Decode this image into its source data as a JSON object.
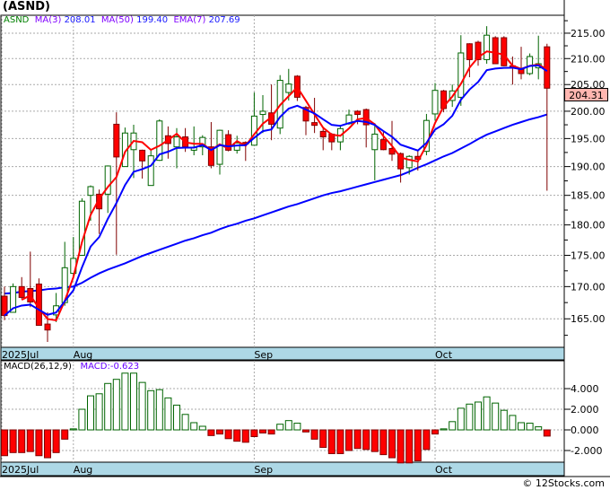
{
  "title": "(ASND)",
  "legend": {
    "symbol": "ASND",
    "ma3_label": "MA(3)",
    "ma3_value": "208.01",
    "ma50_label": "MA(50)",
    "ma50_value": "199.40",
    "ema7_label": "EMA(7)",
    "ema7_value": "207.69"
  },
  "last_price": "204.31",
  "macd_legend": {
    "label": "MACD(26,12,9)",
    "value": "MACD:-0.623"
  },
  "footer": "© 12Stocks.com",
  "colors": {
    "up": "#006400",
    "down": "#ff0000",
    "down_edge": "#800000",
    "ma3": "#ff0000",
    "ema7": "#0000ff",
    "ma50": "#0000ff",
    "axis_band": "#add8e6",
    "last_box": "#ffb6b0"
  },
  "chart_data": [
    {
      "type": "candlestick",
      "scale": "log",
      "ylim": [
        160.7,
        218.6
      ],
      "grid": true,
      "yticks": [
        "215.00",
        "210.00",
        "205.00",
        "200.00",
        "195.00",
        "190.00",
        "185.00",
        "180.00",
        "175.00",
        "170.00",
        "165.00"
      ],
      "xticks": [
        {
          "label": "2025Jul",
          "index": 0
        },
        {
          "label": "Aug",
          "index": 8
        },
        {
          "label": "Sep",
          "index": 29
        },
        {
          "label": "Oct",
          "index": 50
        }
      ],
      "ohlc": [
        [
          168.5,
          170,
          164.8,
          165.5
        ],
        [
          166,
          170.5,
          166,
          170
        ],
        [
          170,
          171.5,
          168,
          168.3
        ],
        [
          169.7,
          175.6,
          166.8,
          167.6
        ],
        [
          170.4,
          171.3,
          164,
          164
        ],
        [
          164.2,
          166,
          161.5,
          163.3
        ],
        [
          165.6,
          169,
          164.5,
          167
        ],
        [
          167.5,
          177.2,
          167,
          173
        ],
        [
          172.1,
          178,
          171.5,
          174.5
        ],
        [
          175,
          184.5,
          175,
          184
        ],
        [
          185,
          186.7,
          180.7,
          186.5
        ],
        [
          185.2,
          186,
          178.5,
          182.7
        ],
        [
          185.2,
          190.2,
          182,
          190.1
        ],
        [
          197.6,
          199.8,
          175.1,
          191.7
        ],
        [
          190,
          197,
          190,
          196
        ],
        [
          193,
          197.5,
          188,
          196
        ],
        [
          192.9,
          193,
          187.9,
          191
        ],
        [
          186.7,
          193,
          186.7,
          191.9
        ],
        [
          191.1,
          198.5,
          191,
          198.2
        ],
        [
          195.5,
          197.2,
          191.4,
          194.1
        ],
        [
          193.5,
          196.9,
          189.7,
          195.3
        ],
        [
          195.3,
          196.9,
          192.6,
          193.5
        ],
        [
          192.9,
          197.2,
          192,
          193.4
        ],
        [
          193.5,
          195.6,
          192,
          195.2
        ],
        [
          193.5,
          198,
          189.7,
          190.2
        ],
        [
          190.4,
          196.6,
          188.6,
          196.5
        ],
        [
          195.7,
          196.5,
          192.7,
          192.9
        ],
        [
          192.9,
          195.5,
          192.3,
          194.2
        ],
        [
          194.3,
          194.5,
          191,
          194
        ],
        [
          193.8,
          203.5,
          193.8,
          199.1
        ],
        [
          199.4,
          203,
          196,
          200
        ],
        [
          199.7,
          205,
          194.7,
          197.6
        ],
        [
          196.9,
          206.8,
          195.8,
          205.8
        ],
        [
          203.5,
          208,
          202,
          205.1
        ],
        [
          206.6,
          206.8,
          201.9,
          202.6
        ],
        [
          200.7,
          201,
          195.6,
          198.2
        ],
        [
          197.9,
          202.5,
          196,
          197.4
        ],
        [
          196.3,
          196.8,
          192.9,
          195.3
        ],
        [
          195.8,
          196,
          192.9,
          194.4
        ],
        [
          194.4,
          197.3,
          192.9,
          196.8
        ],
        [
          197.7,
          200.3,
          197.5,
          199.3
        ],
        [
          200,
          200.2,
          197.6,
          199.4
        ],
        [
          200.3,
          200.5,
          193.4,
          197.5
        ],
        [
          193,
          197.8,
          187.6,
          195.8
        ],
        [
          194.8,
          196.3,
          192.9,
          193
        ],
        [
          193.2,
          198.2,
          191,
          192.2
        ],
        [
          192.3,
          192.5,
          187.2,
          189.6
        ],
        [
          189.8,
          192,
          188.6,
          191.8
        ],
        [
          191.8,
          192.9,
          189.3,
          191.3
        ],
        [
          192.7,
          199.5,
          192,
          198.3
        ],
        [
          199.5,
          205.3,
          198.3,
          203.9
        ],
        [
          203.8,
          204,
          199.8,
          200.5
        ],
        [
          202,
          205,
          200.8,
          203.8
        ],
        [
          202.6,
          214.6,
          201,
          211.1
        ],
        [
          212.9,
          213,
          206.4,
          209.8
        ],
        [
          213.2,
          213.5,
          208.6,
          209.8
        ],
        [
          209.8,
          216.4,
          209,
          214.6
        ],
        [
          214.1,
          214.4,
          209,
          209
        ],
        [
          214.1,
          214.4,
          208.5,
          208.6
        ],
        [
          208.6,
          210.4,
          205,
          208.3
        ],
        [
          207.9,
          212.3,
          206,
          207.1
        ],
        [
          207.1,
          211,
          206.8,
          210.4
        ],
        [
          208.2,
          214.5,
          206,
          209
        ],
        [
          212.3,
          212.9,
          185.8,
          204.31
        ]
      ],
      "ma50": [
        168.9,
        169.0,
        169.2,
        169.3,
        169.4,
        169.6,
        169.7,
        169.9,
        170.0,
        170.6,
        171.4,
        172.1,
        172.7,
        173.2,
        173.7,
        174.3,
        174.9,
        175.4,
        175.9,
        176.4,
        176.9,
        177.4,
        177.8,
        178.3,
        178.7,
        179.3,
        179.8,
        180.2,
        180.7,
        181.1,
        181.6,
        182.1,
        182.6,
        183.1,
        183.5,
        184.0,
        184.5,
        185.0,
        185.4,
        185.7,
        186.1,
        186.5,
        186.9,
        187.3,
        187.7,
        188.1,
        188.5,
        189.1,
        189.8,
        190.4,
        191.1,
        191.8,
        192.4,
        193.2,
        194.0,
        194.9,
        195.7,
        196.3,
        196.9,
        197.5,
        198.0,
        198.5,
        198.9,
        199.4
      ]
    },
    {
      "type": "bar",
      "name": "MACD(26,12,9)",
      "ylim": [
        -3130,
        6700
      ],
      "grid": true,
      "yticks": [
        {
          "label": "4.000",
          "value": 4000
        },
        {
          "label": "2.000",
          "value": 2000
        },
        {
          "label": "0.000",
          "value": 0
        },
        {
          "label": "-2.000",
          "value": -2000
        }
      ],
      "xticks": [
        {
          "label": "2025Jul",
          "index": 0
        },
        {
          "label": "Aug",
          "index": 8
        },
        {
          "label": "Sep",
          "index": 29
        },
        {
          "label": "Oct",
          "index": 50
        }
      ],
      "values": [
        -2500,
        -2200,
        -2200,
        -2100,
        -2500,
        -2700,
        -2200,
        -900,
        100,
        2000,
        3300,
        3500,
        4500,
        4900,
        5500,
        5500,
        4600,
        3800,
        3900,
        3100,
        2400,
        1500,
        700,
        350,
        -550,
        -400,
        -850,
        -1100,
        -1200,
        -650,
        -300,
        -400,
        550,
        900,
        650,
        -200,
        -900,
        -1700,
        -2300,
        -2300,
        -2000,
        -1800,
        -1900,
        -2100,
        -2400,
        -2700,
        -3200,
        -3200,
        -3000,
        -1900,
        -400,
        100,
        800,
        2100,
        2500,
        2700,
        3200,
        2600,
        1900,
        1400,
        700,
        650,
        300,
        -600
      ]
    }
  ]
}
